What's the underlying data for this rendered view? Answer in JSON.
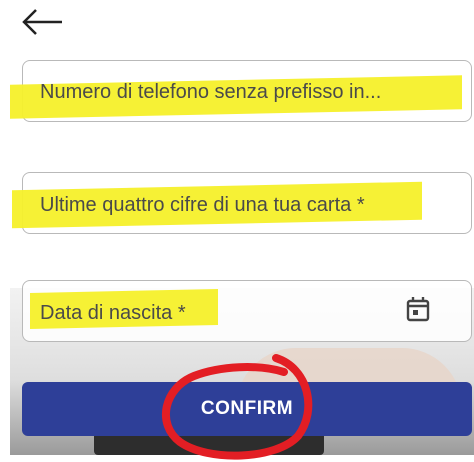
{
  "header": {
    "back_icon": "arrow-left-icon"
  },
  "form": {
    "phone_placeholder": "Numero di telefono senza prefisso in...",
    "card_digits_placeholder": "Ultime quattro cifre di una tua carta",
    "card_digits_required": "*",
    "birthdate_placeholder": "Data di nascita",
    "birthdate_required": "*",
    "calendar_icon": "calendar-icon"
  },
  "actions": {
    "confirm_label": "CONFIRM"
  },
  "colors": {
    "highlight": "#f6f02a",
    "button": "#2e3f98",
    "circle": "#e31e24"
  }
}
